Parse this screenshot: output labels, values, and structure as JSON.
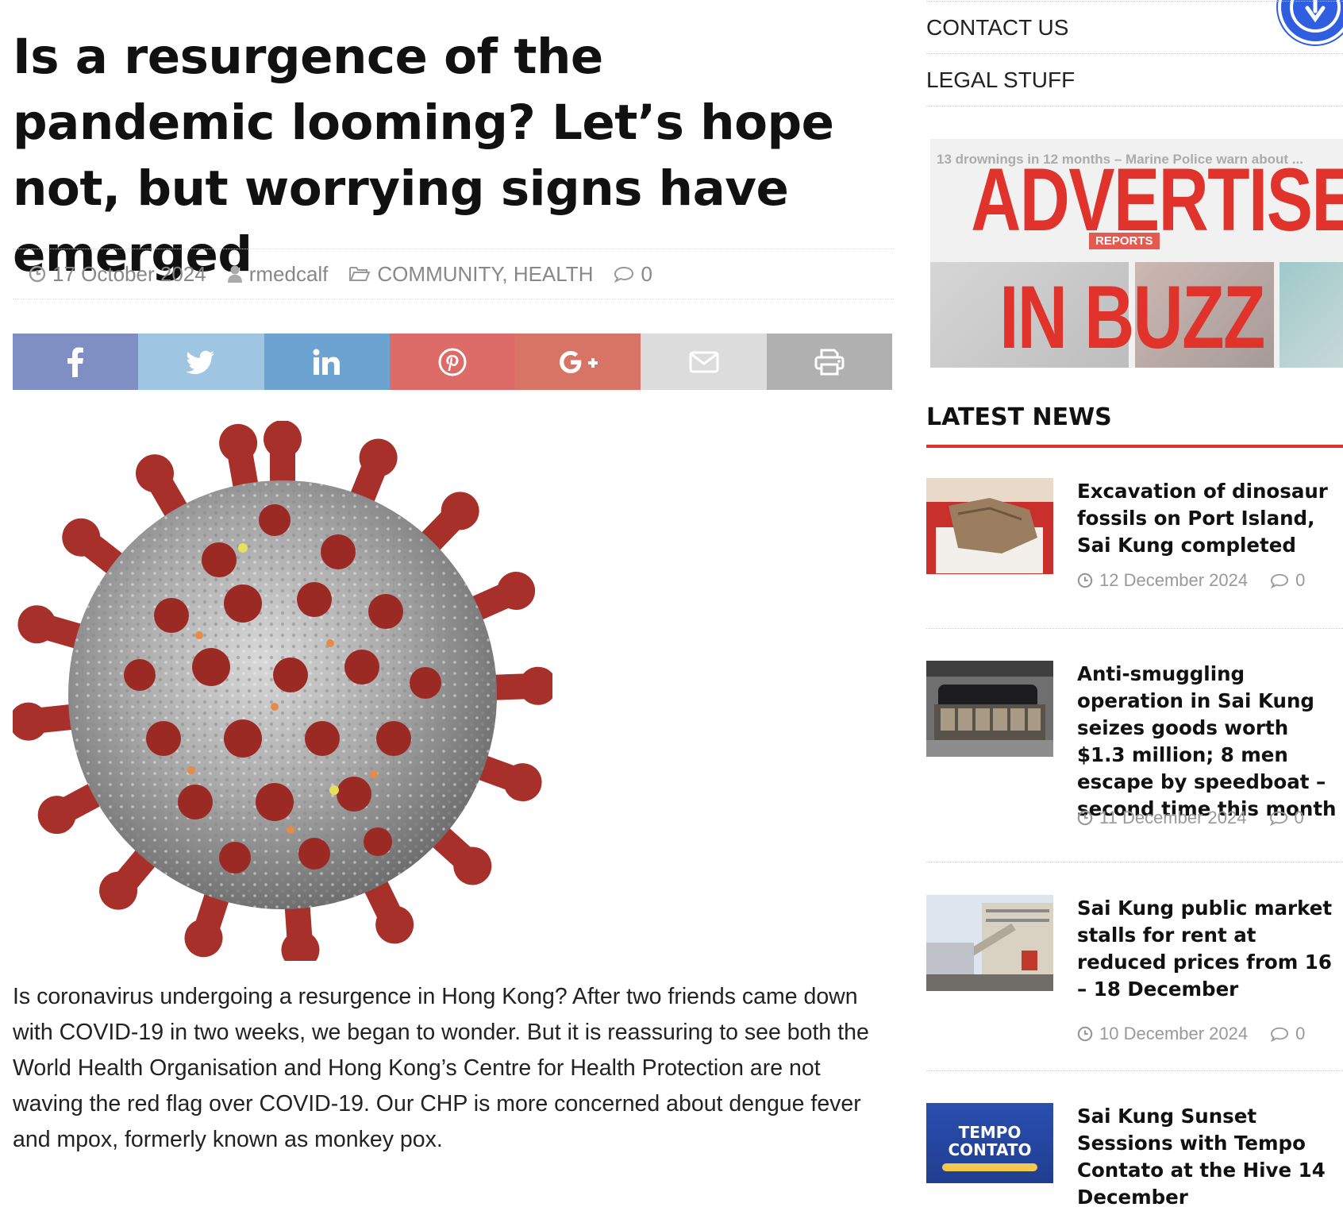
{
  "article": {
    "title": "Is a resurgence of the pandemic looming? Let’s hope not, but worrying signs have emerged",
    "date": "17 October 2024",
    "author": "rmedcalf",
    "categories": "COMMUNITY, HEALTH",
    "comments": "0",
    "body": "Is coronavirus undergoing a resurgence in Hong Kong? After two friends came down with COVID-19 in two weeks, we began to wonder. But it is reassuring to see both the World Health Organisation and Hong Kong’s Centre for Health Protection are not waving the red flag over COVID-19. Our CHP is more concerned about dengue fever and mpox, formerly known as monkey pox."
  },
  "share": [
    {
      "name": "facebook",
      "icon": "facebook-icon",
      "color": "#7f8fc4"
    },
    {
      "name": "twitter",
      "icon": "twitter-icon",
      "color": "#9ec5e2"
    },
    {
      "name": "linkedin",
      "icon": "linkedin-icon",
      "color": "#6ca3d0"
    },
    {
      "name": "pinterest",
      "icon": "pinterest-icon",
      "color": "#dd6c69"
    },
    {
      "name": "google-plus",
      "icon": "google-plus-icon",
      "color": "#d87466"
    },
    {
      "name": "email",
      "icon": "envelope-icon",
      "color": "#dcdcdc"
    },
    {
      "name": "print",
      "icon": "printer-icon",
      "color": "#b0b0b0"
    }
  ],
  "sidebar": {
    "nav": [
      "CONTACT US",
      "LEGAL STUFF"
    ],
    "ad": {
      "line1": "ADVERTISE",
      "line2": "IN BUZZ",
      "background_text": "13 drownings in 12 months – Marine Police warn about ...",
      "badge": "REPORTS"
    },
    "latest_heading": "LATEST NEWS",
    "news": [
      {
        "headline": "Excavation of dinosaur fossils on Port Island, Sai Kung completed",
        "date": "12 December 2024",
        "comments": "0"
      },
      {
        "headline": "Anti-smuggling operation in Sai Kung seizes goods worth $1.3 million; 8 men escape by speedboat – second time this month",
        "date": "11 December 2024",
        "comments": "0"
      },
      {
        "headline": "Sai Kung public market stalls for rent at reduced prices from 16 – 18 December",
        "date": "10 December 2024",
        "comments": "0"
      },
      {
        "headline": "Sai Kung Sunset Sessions with Tempo Contato at the Hive 14 December",
        "date": "",
        "comments": ""
      }
    ],
    "tempo_thumb": {
      "line1": "TEMPO",
      "line2": "CONTATO"
    }
  },
  "colors": {
    "accent": "#e0332c",
    "accessibility": "#2f5fe0"
  }
}
